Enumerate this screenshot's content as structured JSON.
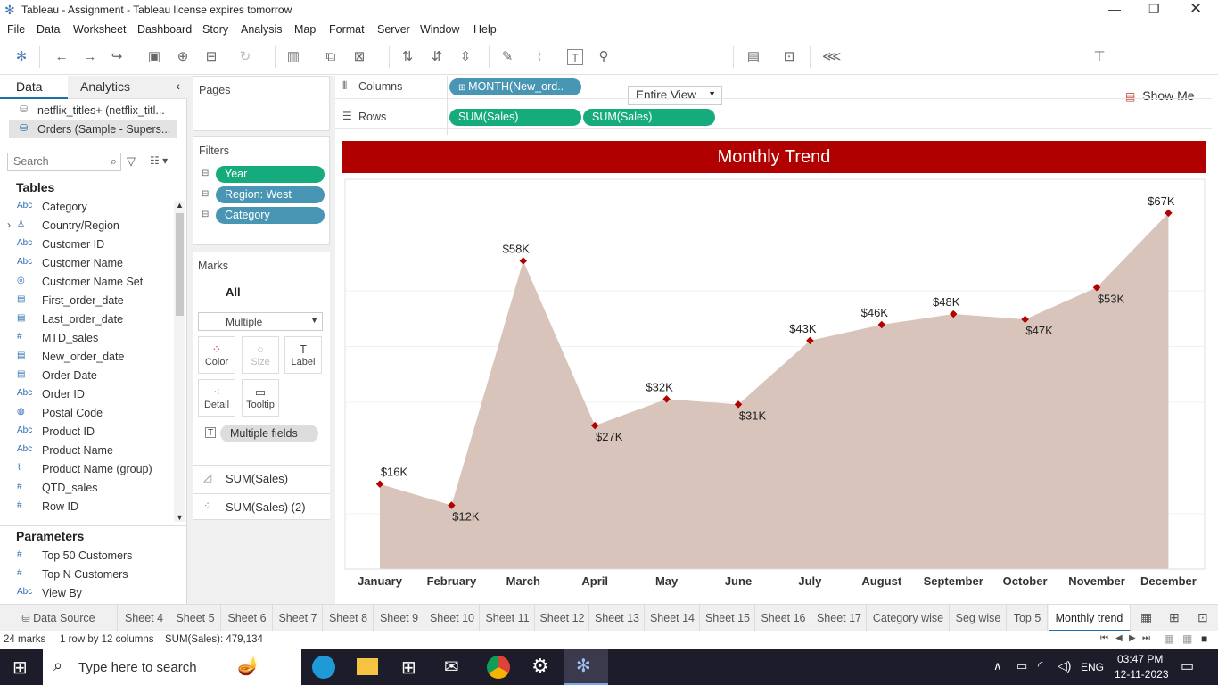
{
  "window": {
    "title": "Tableau - Assignment - Tableau license expires tomorrow"
  },
  "menu": [
    "File",
    "Data",
    "Worksheet",
    "Dashboard",
    "Story",
    "Analysis",
    "Map",
    "Format",
    "Server",
    "Window",
    "Help"
  ],
  "toolbar": {
    "fit": "Entire View",
    "show_me": "Show Me"
  },
  "left": {
    "tab_data": "Data",
    "tab_analytics": "Analytics",
    "sources": [
      "netflix_titles+ (netflix_titl...",
      "Orders (Sample - Supers..."
    ],
    "search_placeholder": "Search",
    "tables_title": "Tables",
    "fields": [
      {
        "t": "Abc",
        "n": "Category"
      },
      {
        "t": "geo",
        "n": "Country/Region"
      },
      {
        "t": "Abc",
        "n": "Customer ID"
      },
      {
        "t": "Abc",
        "n": "Customer Name"
      },
      {
        "t": "set",
        "n": "Customer Name Set"
      },
      {
        "t": "date",
        "n": "First_order_date"
      },
      {
        "t": "date",
        "n": "Last_order_date"
      },
      {
        "t": "#",
        "n": "MTD_sales"
      },
      {
        "t": "date",
        "n": "New_order_date"
      },
      {
        "t": "date",
        "n": "Order Date"
      },
      {
        "t": "Abc",
        "n": "Order ID"
      },
      {
        "t": "globe",
        "n": "Postal Code"
      },
      {
        "t": "Abc",
        "n": "Product ID"
      },
      {
        "t": "Abc",
        "n": "Product Name"
      },
      {
        "t": "clip",
        "n": "Product Name (group)"
      },
      {
        "t": "#",
        "n": "QTD_sales"
      },
      {
        "t": "#",
        "n": "Row ID"
      }
    ],
    "params_title": "Parameters",
    "params": [
      {
        "t": "#",
        "n": "Top 50 Customers"
      },
      {
        "t": "#",
        "n": "Top N Customers"
      },
      {
        "t": "Abc",
        "n": "View By"
      }
    ]
  },
  "cards": {
    "pages": "Pages",
    "filters": "Filters",
    "filter_items": [
      "Year",
      "Region: West",
      "Category"
    ],
    "marks": "Marks",
    "marks_all": "All",
    "mark_type": "Multiple",
    "buttons": [
      "Color",
      "Size",
      "Label",
      "Detail",
      "Tooltip"
    ],
    "multiple_fields": "Multiple fields",
    "mark_layers": [
      "SUM(Sales)",
      "SUM(Sales) (2)"
    ]
  },
  "shelves": {
    "columns_label": "Columns",
    "rows_label": "Rows",
    "columns_pill": "MONTH(New_ord..",
    "rows_pills": [
      "SUM(Sales)",
      "SUM(Sales)"
    ]
  },
  "chart_data": {
    "type": "area",
    "title": "Monthly Trend",
    "categories": [
      "January",
      "February",
      "March",
      "April",
      "May",
      "June",
      "July",
      "August",
      "September",
      "October",
      "November",
      "December"
    ],
    "values": [
      16,
      12,
      58,
      27,
      32,
      31,
      43,
      46,
      48,
      47,
      53,
      67
    ],
    "labels": [
      "$16K",
      "$12K",
      "$58K",
      "$27K",
      "$32K",
      "$31K",
      "$43K",
      "$46K",
      "$48K",
      "$47K",
      "$53K",
      "$67K"
    ],
    "ylim": [
      0,
      70
    ],
    "colors": {
      "fill": "#d8c4bb",
      "marker": "#b30000",
      "title_bg": "#b00000"
    }
  },
  "sheets": [
    "Data Source",
    "Sheet 4",
    "Sheet 5",
    "Sheet 6",
    "Sheet 7",
    "Sheet 8",
    "Sheet 9",
    "Sheet 10",
    "Sheet 11",
    "Sheet 12",
    "Sheet 13",
    "Sheet 14",
    "Sheet 15",
    "Sheet 16",
    "Sheet 17",
    "Category wise",
    "Seg wise",
    "Top 5",
    "Monthly trend"
  ],
  "status": {
    "marks": "24 marks",
    "rc": "1 row by 12 columns",
    "sum": "SUM(Sales): 479,134"
  },
  "taskbar": {
    "search": "Type here to search",
    "lang": "ENG",
    "time": "03:47 PM",
    "date": "12-11-2023"
  }
}
